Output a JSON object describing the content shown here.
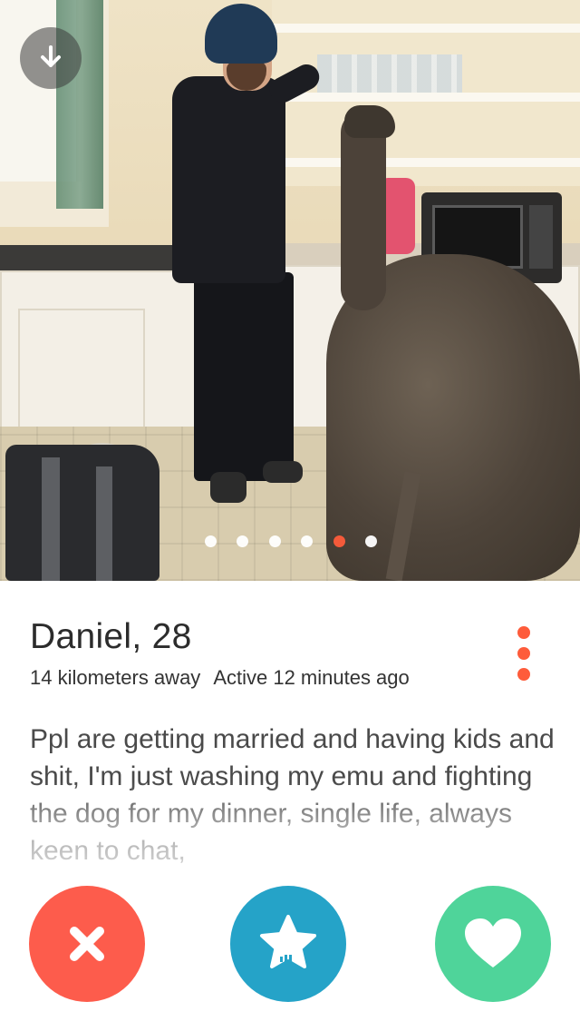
{
  "profile": {
    "name_age": "Daniel, 28",
    "distance": "14 kilometers away",
    "activity": "Active 12 minutes ago",
    "bio": "Ppl are getting married and having kids and shit, I'm just washing my emu and fighting the dog for my dinner, single life, always keen to chat,"
  },
  "carousel": {
    "photo_count": 6,
    "active_index": 4
  },
  "icons": {
    "photo_action": "download-arrow-icon",
    "more": "more-dots-icon",
    "nope": "close-x-icon",
    "super_like": "star-icon",
    "like": "heart-icon"
  },
  "colors": {
    "accent": "#fe5c3b",
    "nope": "#fd5c4c",
    "super_like": "#25a3c8",
    "like": "#4fd49a",
    "dot_inactive": "#ffffff"
  }
}
